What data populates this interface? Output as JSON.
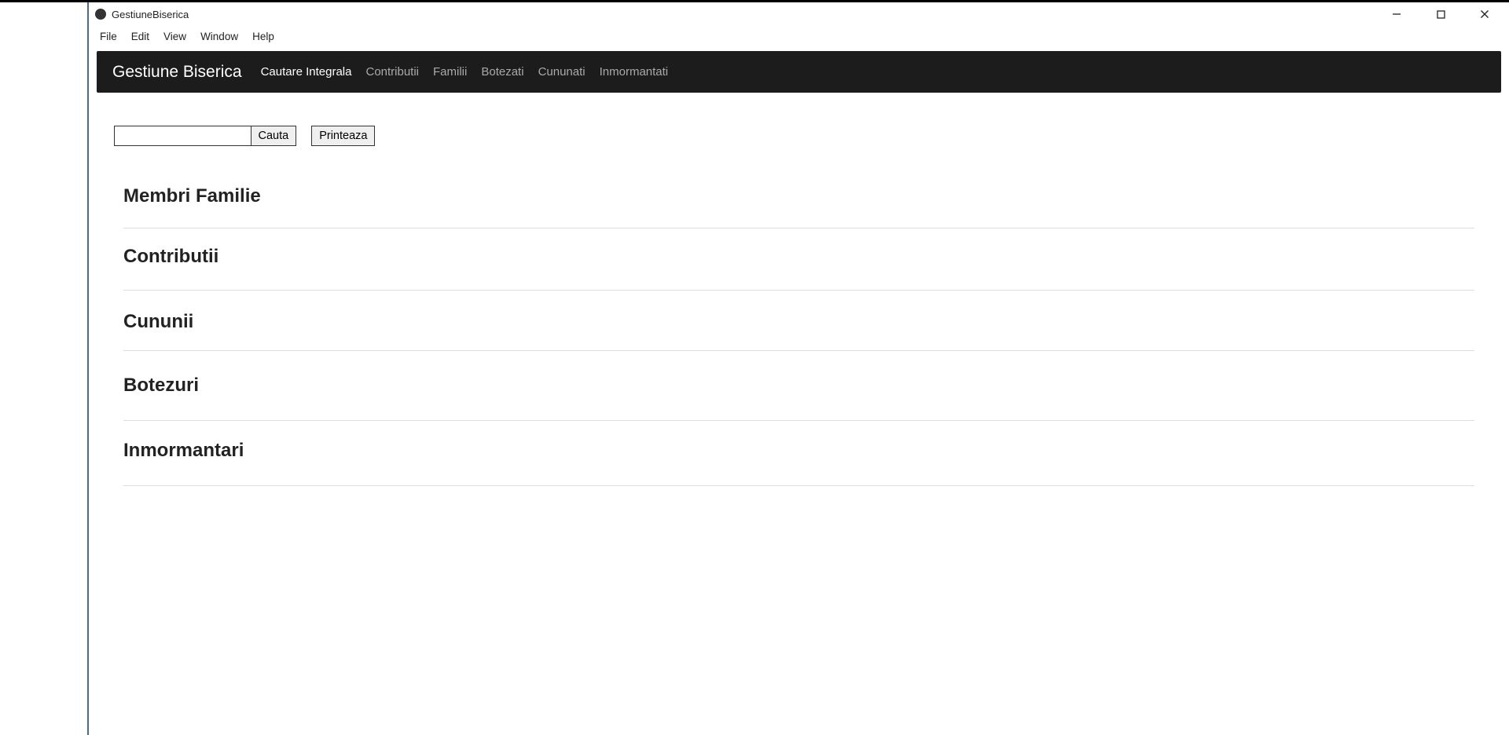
{
  "window": {
    "title": "GestiuneBiserica"
  },
  "menubar": {
    "items": [
      "File",
      "Edit",
      "View",
      "Window",
      "Help"
    ]
  },
  "navbar": {
    "brand": "Gestiune Biserica",
    "items": [
      {
        "label": "Cautare Integrala",
        "active": true
      },
      {
        "label": "Contributii",
        "active": false
      },
      {
        "label": "Familii",
        "active": false
      },
      {
        "label": "Botezati",
        "active": false
      },
      {
        "label": "Cununati",
        "active": false
      },
      {
        "label": "Inmormantati",
        "active": false
      }
    ]
  },
  "search": {
    "value": "",
    "search_label": "Cauta",
    "print_label": "Printeaza"
  },
  "sections": [
    {
      "title": "Membri Familie"
    },
    {
      "title": "Contributii"
    },
    {
      "title": "Cununii"
    },
    {
      "title": "Botezuri"
    },
    {
      "title": "Inmormantari"
    }
  ]
}
